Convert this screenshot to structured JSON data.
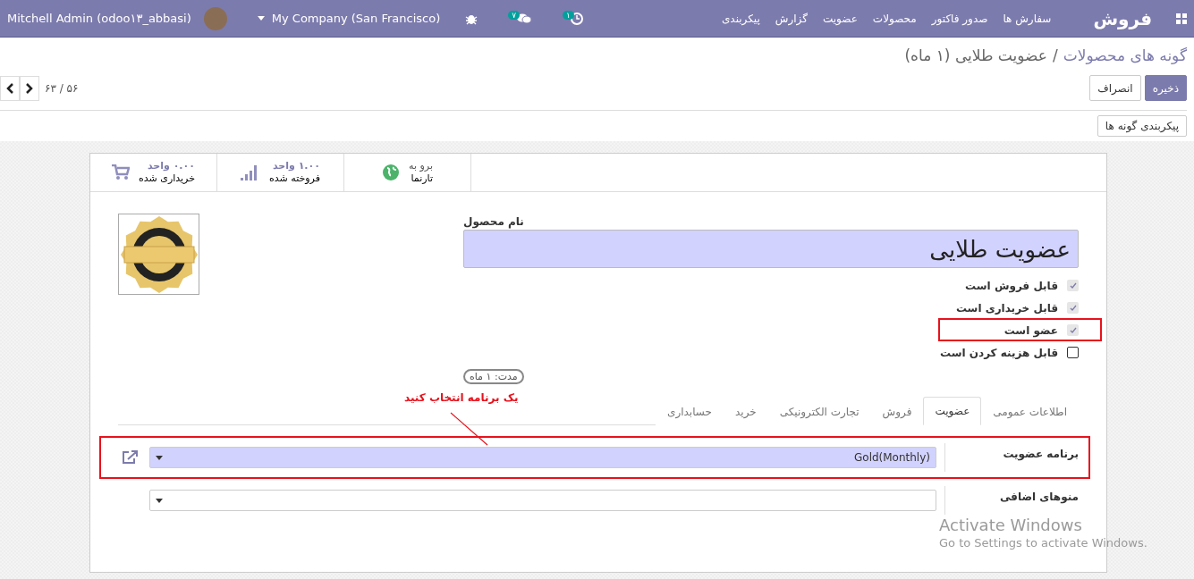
{
  "navbar": {
    "app_name": "فروش",
    "menu": [
      "سفارش ها",
      "صدور فاکتور",
      "محصولات",
      "عضویت",
      "گزارش",
      "پیکربندی"
    ],
    "user": "Mitchell Admin (odoo۱۳_abbasi)",
    "company": "My Company (San Francisco)",
    "messages_count": "۷",
    "activities_count": "۱"
  },
  "breadcrumb": {
    "parent": "گونه های محصولات",
    "separator": "/",
    "current": "عضویت طلایی (۱ ماه)"
  },
  "actions": {
    "save": "ذخیره",
    "discard": "انصراف"
  },
  "pager": "۶۳ / ۵۶",
  "configure_button": "پیکربندی گونه ها",
  "stat_buttons": [
    {
      "kind": "website",
      "line1": "برو به",
      "line2": "تارنما"
    },
    {
      "kind": "sold",
      "line1": "۱.۰۰ واحد",
      "line2": "فروخته شده"
    },
    {
      "kind": "purchased",
      "line1": "۰.۰۰ واحد",
      "line2": "خریداری شده"
    }
  ],
  "product": {
    "name_label": "نام محصول",
    "name": "عضویت طلایی",
    "duration": "مدت: ۱ ماه"
  },
  "options": [
    {
      "label": "قابل فروش است",
      "checked": true,
      "highlighted": false
    },
    {
      "label": "قابل خریداری است",
      "checked": true,
      "highlighted": false
    },
    {
      "label": "عضو است",
      "checked": true,
      "highlighted": true
    },
    {
      "label": "قابل هزینه کردن است",
      "checked": false,
      "highlighted": false
    }
  ],
  "annotation": "یک برنامه انتخاب کنید",
  "tabs": [
    {
      "label": "اطلاعات عمومی",
      "selected": false
    },
    {
      "label": "عضویت",
      "selected": true
    },
    {
      "label": "فروش",
      "selected": false
    },
    {
      "label": "تجارت الکترونیکی",
      "selected": false
    },
    {
      "label": "خرید",
      "selected": false
    },
    {
      "label": "حسابداری",
      "selected": false
    }
  ],
  "fields": [
    {
      "label": "برنامه عضویت",
      "value": "Gold(Monthly)",
      "required": true,
      "highlighted": true
    },
    {
      "label": "منوهای اضافی",
      "required": false,
      "highlighted": false
    }
  ],
  "os_notice": {
    "title": "Activate Windows",
    "subtitle": "Go to Settings to activate Windows."
  }
}
